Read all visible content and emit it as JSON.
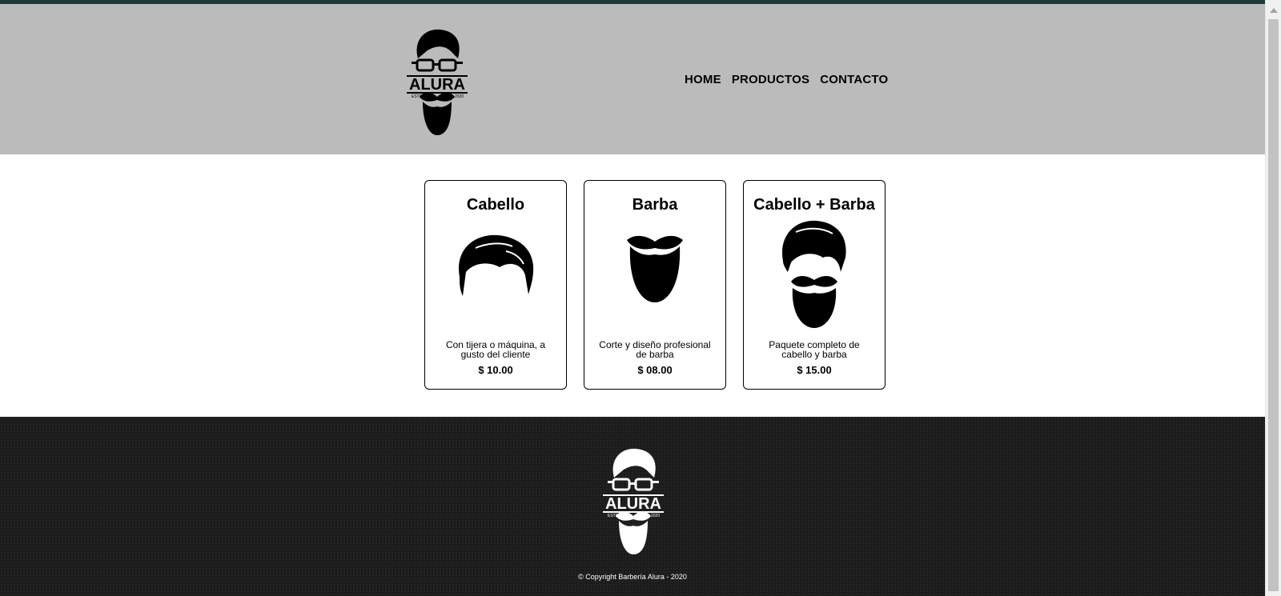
{
  "header": {
    "logo": {
      "text": "ALURA",
      "left_mark": "ESTD",
      "right_mark": "2020"
    },
    "nav": [
      "HOME",
      "PRODUCTOS",
      "CONTACTO"
    ]
  },
  "products": [
    {
      "title": "Cabello",
      "icon": "hair-icon",
      "description": "Con tijera o máquina, a gusto del cliente",
      "price": "$ 10.00"
    },
    {
      "title": "Barba",
      "icon": "beard-icon",
      "description": "Corte y diseño profesional de barba",
      "price": "$ 08.00"
    },
    {
      "title": "Cabello + Barba",
      "icon": "hair-beard-icon",
      "description": "Paquete completo de cabello y barba",
      "price": "$ 15.00"
    }
  ],
  "footer": {
    "logo": {
      "text": "ALURA",
      "left_mark": "ESTD",
      "right_mark": "2020"
    },
    "copyright": "© Copyright Barbería Alura - 2020"
  },
  "colors": {
    "topbar": "#223a36",
    "header_bg": "#bbbbbb",
    "footer_bg": "#1b1c1b"
  }
}
